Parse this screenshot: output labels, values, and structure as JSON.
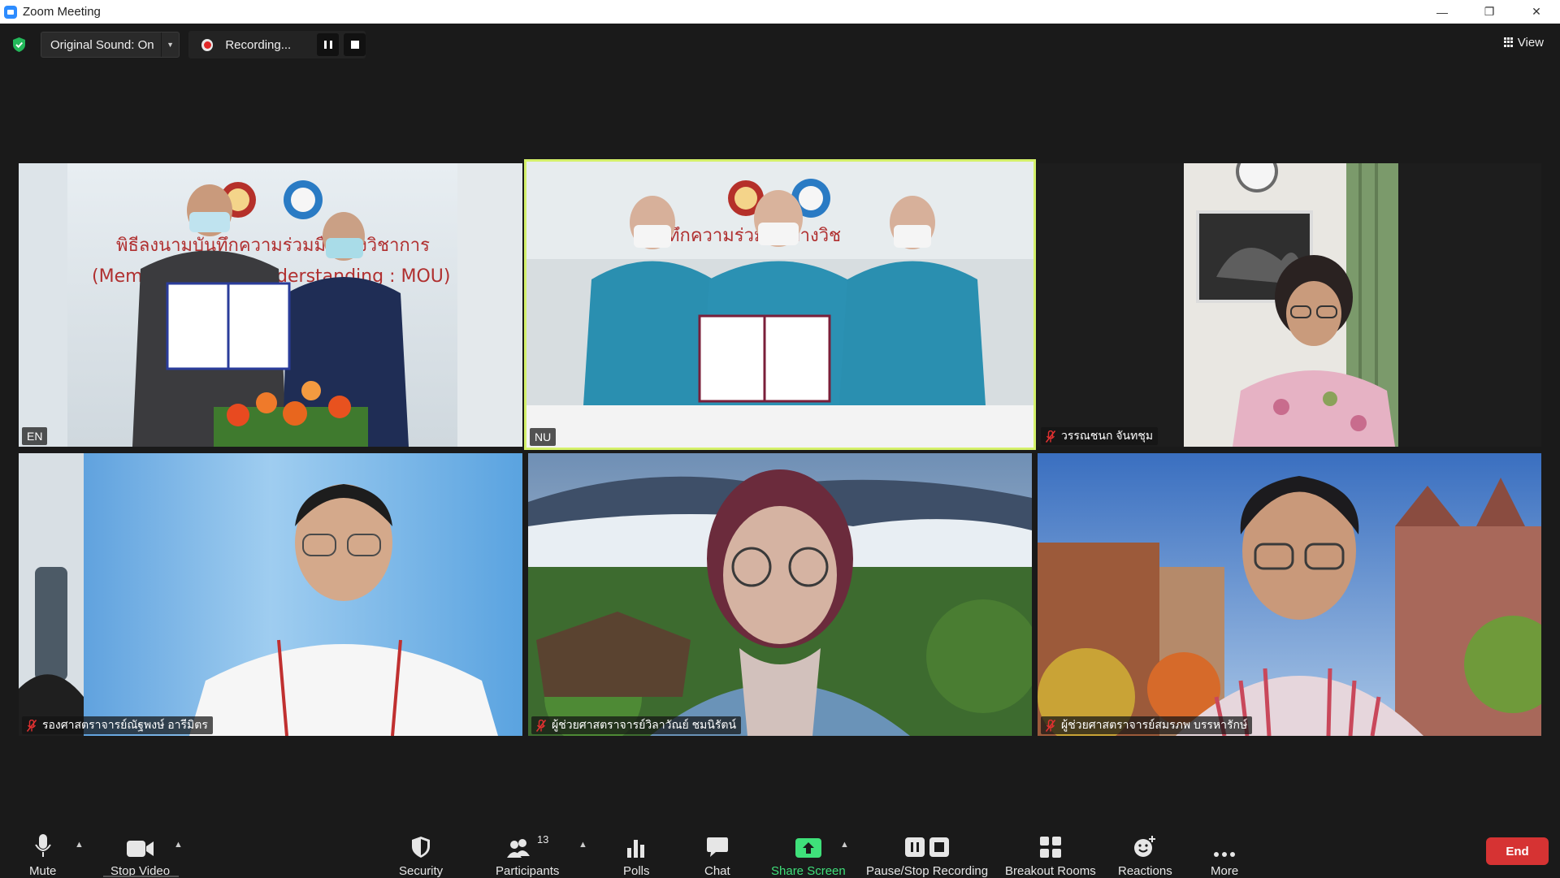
{
  "window": {
    "title": "Zoom Meeting",
    "minimize": "—",
    "restore": "❐",
    "close": "✕"
  },
  "topbar": {
    "original_sound": "Original Sound: On",
    "recording": "Recording...",
    "view": "View"
  },
  "tiles": [
    {
      "name": "EN",
      "muted": false,
      "active": false
    },
    {
      "name": "NU",
      "muted": false,
      "active": true
    },
    {
      "name": "วรรณชนก จันทชุม",
      "muted": true,
      "active": false
    },
    {
      "name": "รองศาสตราจารย์ณัฐพงษ์ อารีมิตร",
      "muted": true,
      "active": false
    },
    {
      "name": "ผู้ช่วยศาสตราจารย์วิลาวัณย์ ชมนิรัตน์",
      "muted": true,
      "active": false
    },
    {
      "name": "ผู้ช่วยศาสตราจารย์สมรภพ บรรหารักษ์",
      "muted": true,
      "active": false
    }
  ],
  "slide_text": {
    "line1": "พิธีลงนามบันทึกความร่วมมือทางวิชาการ",
    "line2": "(Memorandum of Understanding : MOU)",
    "line3_tile2": "บันทึกความร่วมมือทางวิช"
  },
  "toolbar": {
    "mute": "Mute",
    "stop_video": "Stop Video",
    "security": "Security",
    "participants": "Participants",
    "participants_count": "13",
    "polls": "Polls",
    "chat": "Chat",
    "share_screen": "Share Screen",
    "pause_stop_recording": "Pause/Stop Recording",
    "breakout_rooms": "Breakout Rooms",
    "reactions": "Reactions",
    "more": "More",
    "end": "End"
  },
  "colors": {
    "accent_green": "#3fe07a",
    "end_red": "#d63333",
    "active_border": "#d4f06a",
    "recording_red": "#e02828",
    "mic_muted_red": "#e03030"
  }
}
